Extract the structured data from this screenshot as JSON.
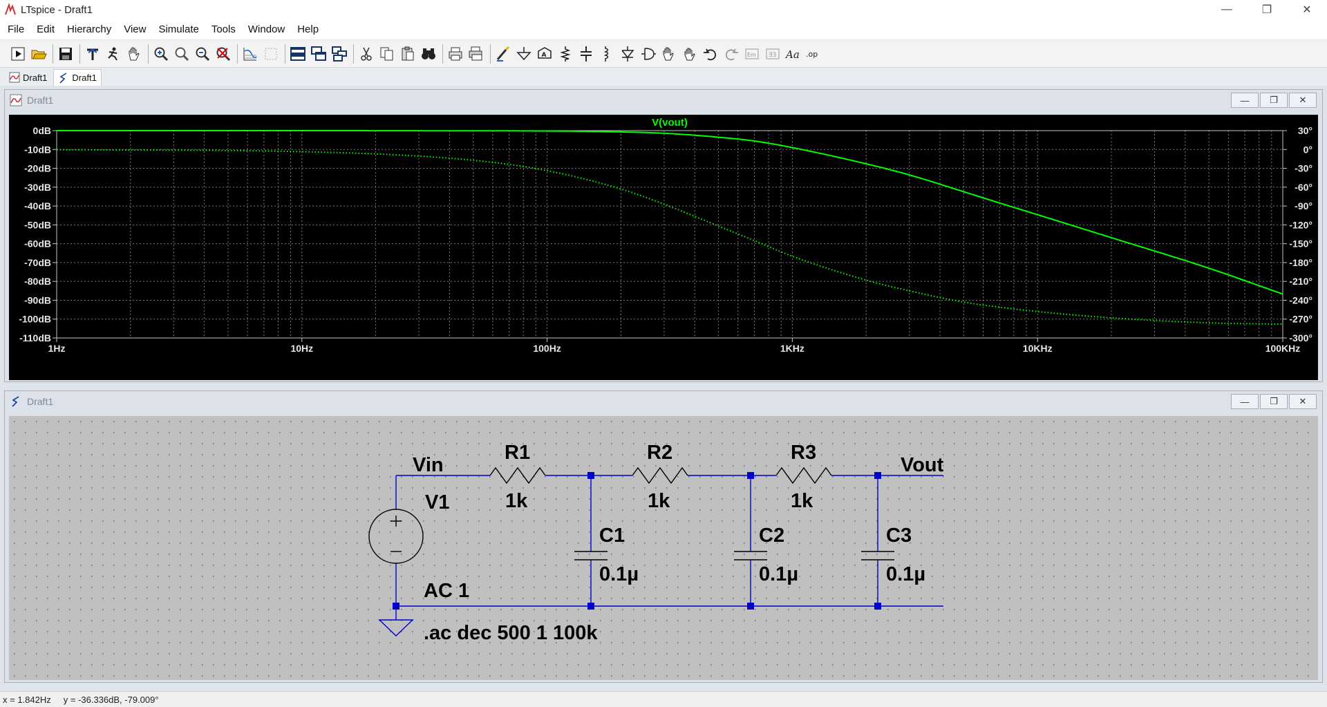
{
  "window": {
    "title": "LTspice - Draft1"
  },
  "menu": [
    "File",
    "Edit",
    "Hierarchy",
    "View",
    "Simulate",
    "Tools",
    "Window",
    "Help"
  ],
  "toolbar_icons": [
    "run-icon",
    "open-icon",
    "save-icon",
    "control-panel-icon",
    "halt-icon",
    "pan-icon",
    "zoom-in-icon",
    "zoom-area-icon",
    "zoom-out-icon",
    "zoom-cancel-icon",
    "autorange-icon",
    "mark-icon",
    "tile-horizontal-icon",
    "cascade-icon",
    "tile-vertical-icon",
    "cut-icon",
    "copy-icon",
    "paste-icon",
    "find-icon",
    "print-icon",
    "print-setup-icon",
    "wire-icon",
    "ground-icon",
    "label-icon",
    "resistor-icon",
    "capacitor-icon",
    "inductor-icon",
    "diode-icon",
    "component-icon",
    "move-icon",
    "drag-icon",
    "undo-icon",
    "redo-icon",
    "rotate-icon",
    "mirror-icon",
    "text-icon",
    "spice-directive-icon"
  ],
  "toolbar_text": {
    "text_tool": "Aa",
    "op_tool": ".op"
  },
  "tabs": [
    {
      "label": "Draft1",
      "icon": "waveform-icon",
      "active": false
    },
    {
      "label": "Draft1",
      "icon": "schematic-icon",
      "active": true
    }
  ],
  "plot_window": {
    "title": "Draft1"
  },
  "schematic_window": {
    "title": "Draft1"
  },
  "chart_data": {
    "type": "line",
    "title": "V(vout)",
    "xscale": "log",
    "xlim": [
      1,
      100000
    ],
    "x_ticks": [
      "1Hz",
      "10Hz",
      "100Hz",
      "1KHz",
      "10KHz",
      "100KHz"
    ],
    "ylim": [
      -110,
      0
    ],
    "y_ticks_left": [
      "0dB",
      "-10dB",
      "-20dB",
      "-30dB",
      "-40dB",
      "-50dB",
      "-60dB",
      "-70dB",
      "-80dB",
      "-90dB",
      "-100dB",
      "-110dB"
    ],
    "y2lim": [
      -300,
      30
    ],
    "y_ticks_right": [
      "30°",
      "0°",
      "-30°",
      "-60°",
      "-90°",
      "-120°",
      "-150°",
      "-180°",
      "-210°",
      "-240°",
      "-270°",
      "-300°"
    ],
    "grid": true,
    "color": "#00ff00",
    "series": [
      {
        "name": "V(vout)",
        "quantity": "magnitude (dB)",
        "style": "solid",
        "x": [
          1,
          10,
          50,
          100,
          200,
          300,
          500,
          700,
          1000,
          2000,
          3000,
          5000,
          7000,
          10000,
          20000,
          50000,
          100000
        ],
        "y": [
          0,
          0,
          -0.1,
          -0.2,
          -0.7,
          -1.4,
          -3.5,
          -5.5,
          -9.0,
          -17.6,
          -23.5,
          -32.4,
          -38.4,
          -44.6,
          -56.8,
          -73.0,
          -86.7
        ]
      },
      {
        "name": "V(vout)",
        "quantity": "phase (deg)",
        "style": "dotted",
        "x": [
          1,
          10,
          50,
          100,
          200,
          300,
          500,
          700,
          1000,
          2000,
          3000,
          5000,
          7000,
          10000,
          20000,
          50000,
          100000
        ],
        "y": [
          -0.35,
          -3.5,
          -17.2,
          -33.7,
          -62.9,
          -87.1,
          -122,
          -145,
          -170,
          -208,
          -225,
          -243,
          -251,
          -258,
          -268,
          -276,
          -278
        ]
      }
    ]
  },
  "schematic": {
    "net_vin": "Vin",
    "net_vout": "Vout",
    "r1_name": "R1",
    "r1_value": "1k",
    "r2_name": "R2",
    "r2_value": "1k",
    "r3_name": "R3",
    "r3_value": "1k",
    "c1_name": "C1",
    "c1_value": "0.1µ",
    "c2_name": "C2",
    "c2_value": "0.1µ",
    "c3_name": "C3",
    "c3_value": "0.1µ",
    "v1_name": "V1",
    "v1_value": "AC 1",
    "directive": ".ac dec 500 1 100k",
    "wire_color": "#0000cc",
    "background": "#c0c0c0"
  },
  "status": {
    "x": "x = 1.842Hz",
    "y": "y = -36.336dB, -79.009°"
  }
}
